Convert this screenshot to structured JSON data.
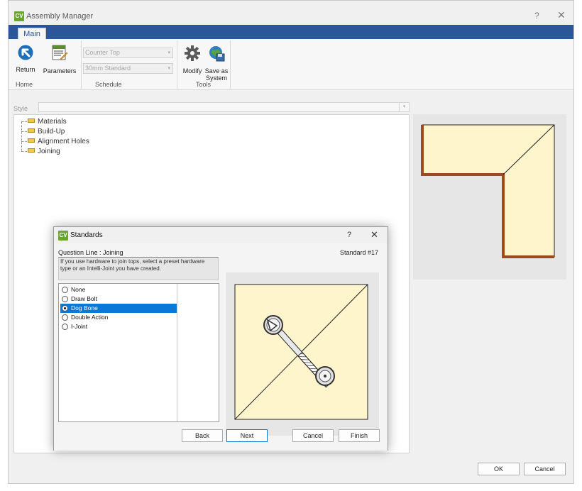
{
  "window": {
    "title": "Assembly Manager",
    "help": "?",
    "close": "✕",
    "logo": "CV"
  },
  "ribbon": {
    "tab": "Main",
    "return_label": "Return",
    "parameters_label": "Parameters",
    "schedule_combo_1": "Counter Top",
    "schedule_combo_2": "30mm Standard",
    "modify_label": "Modify",
    "save_as_system_label_1": "Save as",
    "save_as_system_label_2": "System",
    "group_home": "Home",
    "group_schedule": "Schedule",
    "group_tools": "Tools"
  },
  "style": {
    "label": "Style",
    "value": ""
  },
  "tree": {
    "items": [
      "Materials",
      "Build-Up",
      "Alignment Holes",
      "Joining"
    ]
  },
  "footer": {
    "ok": "OK",
    "cancel": "Cancel"
  },
  "colors": {
    "accent": "#2b579a",
    "selection": "#0a78d7",
    "panel_fill": "#fff5cc",
    "edge": "#9c4a1e",
    "logo": "#6aa62c"
  },
  "dialog": {
    "title": "Standards",
    "help": "?",
    "close": "✕",
    "question": "Question Line : Joining",
    "standard_no": "Standard #17",
    "description": "If you use hardware to join tops, select a preset hardware type or an Intelli-Joint you have created.",
    "options": [
      {
        "label": "None",
        "selected": false
      },
      {
        "label": "Draw Bolt",
        "selected": false
      },
      {
        "label": "Dog Bone",
        "selected": true
      },
      {
        "label": "Double Action",
        "selected": false
      },
      {
        "label": "I-Joint",
        "selected": false
      }
    ],
    "back": "Back",
    "next": "Next",
    "cancel": "Cancel",
    "finish": "Finish"
  }
}
